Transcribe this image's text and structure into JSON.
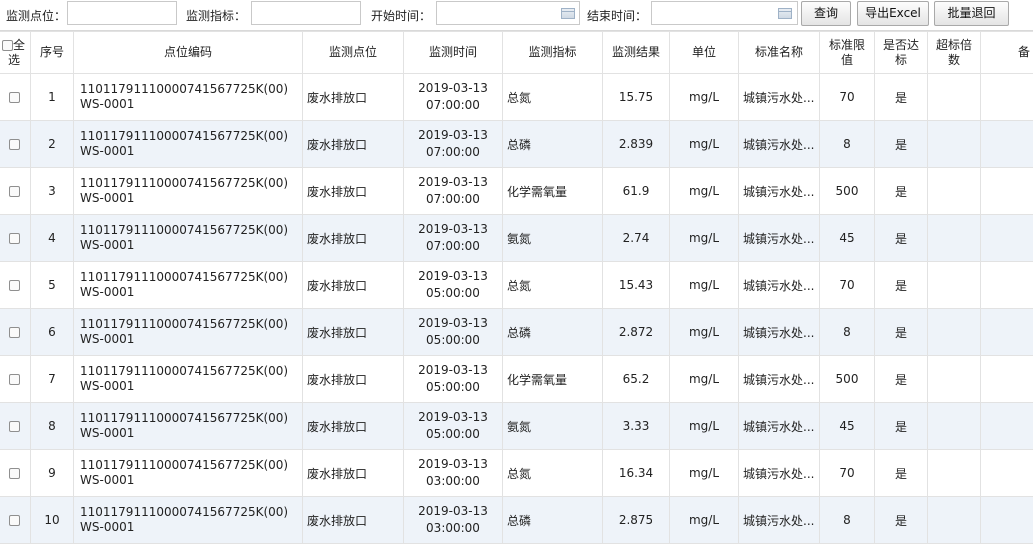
{
  "filters": {
    "point_label": "监测点位：",
    "point_value": "",
    "indicator_label": "监测指标：",
    "indicator_value": "",
    "start_label": "开始时间：",
    "start_value": "",
    "end_label": "结束时间：",
    "end_value": ""
  },
  "buttons": {
    "query": "查询",
    "export": "导出Excel",
    "batch_return": "批量退回"
  },
  "table": {
    "columns": {
      "select_all_1": "全",
      "select_all_2": "选",
      "index": "序号",
      "code": "点位编码",
      "point": "监测点位",
      "time": "监测时间",
      "indicator": "监测指标",
      "result": "监测结果",
      "unit": "单位",
      "standard_name": "标准名称",
      "limit_1": "标准限",
      "limit_2": "值",
      "compliant_1": "是否达",
      "compliant_2": "标",
      "exceed_1": "超标倍",
      "exceed_2": "数",
      "remark": "备"
    },
    "rows": [
      {
        "idx": "1",
        "code": "11011791110000741567725K(00)WS-0001",
        "point": "废水排放口",
        "date": "2019-03-13",
        "time": "07:00:00",
        "indicator": "总氮",
        "result": "15.75",
        "unit": "mg/L",
        "std": "城镇污水处...",
        "limit": "70",
        "compliant": "是",
        "exceed": "",
        "remark": ""
      },
      {
        "idx": "2",
        "code": "11011791110000741567725K(00)WS-0001",
        "point": "废水排放口",
        "date": "2019-03-13",
        "time": "07:00:00",
        "indicator": "总磷",
        "result": "2.839",
        "unit": "mg/L",
        "std": "城镇污水处...",
        "limit": "8",
        "compliant": "是",
        "exceed": "",
        "remark": ""
      },
      {
        "idx": "3",
        "code": "11011791110000741567725K(00)WS-0001",
        "point": "废水排放口",
        "date": "2019-03-13",
        "time": "07:00:00",
        "indicator": "化学需氧量",
        "result": "61.9",
        "unit": "mg/L",
        "std": "城镇污水处...",
        "limit": "500",
        "compliant": "是",
        "exceed": "",
        "remark": ""
      },
      {
        "idx": "4",
        "code": "11011791110000741567725K(00)WS-0001",
        "point": "废水排放口",
        "date": "2019-03-13",
        "time": "07:00:00",
        "indicator": "氨氮",
        "result": "2.74",
        "unit": "mg/L",
        "std": "城镇污水处...",
        "limit": "45",
        "compliant": "是",
        "exceed": "",
        "remark": ""
      },
      {
        "idx": "5",
        "code": "11011791110000741567725K(00)WS-0001",
        "point": "废水排放口",
        "date": "2019-03-13",
        "time": "05:00:00",
        "indicator": "总氮",
        "result": "15.43",
        "unit": "mg/L",
        "std": "城镇污水处...",
        "limit": "70",
        "compliant": "是",
        "exceed": "",
        "remark": ""
      },
      {
        "idx": "6",
        "code": "11011791110000741567725K(00)WS-0001",
        "point": "废水排放口",
        "date": "2019-03-13",
        "time": "05:00:00",
        "indicator": "总磷",
        "result": "2.872",
        "unit": "mg/L",
        "std": "城镇污水处...",
        "limit": "8",
        "compliant": "是",
        "exceed": "",
        "remark": ""
      },
      {
        "idx": "7",
        "code": "11011791110000741567725K(00)WS-0001",
        "point": "废水排放口",
        "date": "2019-03-13",
        "time": "05:00:00",
        "indicator": "化学需氧量",
        "result": "65.2",
        "unit": "mg/L",
        "std": "城镇污水处...",
        "limit": "500",
        "compliant": "是",
        "exceed": "",
        "remark": ""
      },
      {
        "idx": "8",
        "code": "11011791110000741567725K(00)WS-0001",
        "point": "废水排放口",
        "date": "2019-03-13",
        "time": "05:00:00",
        "indicator": "氨氮",
        "result": "3.33",
        "unit": "mg/L",
        "std": "城镇污水处...",
        "limit": "45",
        "compliant": "是",
        "exceed": "",
        "remark": ""
      },
      {
        "idx": "9",
        "code": "11011791110000741567725K(00)WS-0001",
        "point": "废水排放口",
        "date": "2019-03-13",
        "time": "03:00:00",
        "indicator": "总氮",
        "result": "16.34",
        "unit": "mg/L",
        "std": "城镇污水处...",
        "limit": "70",
        "compliant": "是",
        "exceed": "",
        "remark": ""
      },
      {
        "idx": "10",
        "code": "11011791110000741567725K(00)WS-0001",
        "point": "废水排放口",
        "date": "2019-03-13",
        "time": "03:00:00",
        "indicator": "总磷",
        "result": "2.875",
        "unit": "mg/L",
        "std": "城镇污水处...",
        "limit": "8",
        "compliant": "是",
        "exceed": "",
        "remark": ""
      }
    ]
  },
  "colors": {
    "row_alt_bg": "#eef3f9",
    "border": "#e2e2e2"
  },
  "icons": [
    "calendar-icon"
  ]
}
